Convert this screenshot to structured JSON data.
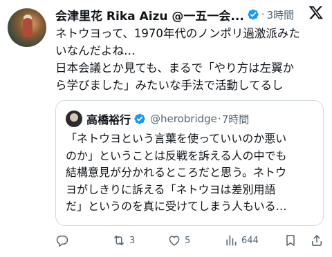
{
  "tweet": {
    "display_name": "会津里花 Rika Aizu @一五一会...",
    "time": "3時間",
    "separator": "·",
    "text_lines": [
      "ネトウヨって、1970年代のノンポリ過激派みた",
      "いなんだよね…",
      "日本会議とか見ても、まるで「やり方は左翼か",
      "ら学びました」みたいな手法で活動してるし"
    ]
  },
  "quote": {
    "display_name": "高橋裕行",
    "handle": "@herobridge",
    "separator": "·",
    "time": "7時間",
    "text_lines": [
      "「ネトウヨという言葉を使っていいのか悪い",
      "のか」ということは反戦を訴える人の中でも",
      "結構意見が分かれるところだと思う。ネトウ",
      "ヨがしきりに訴える「ネトウヨは差別用語",
      "だ」というのを真に受けてしまう人もいる…"
    ]
  },
  "actions": {
    "reply_count": "",
    "retweet_count": "3",
    "like_count": "5",
    "views_count": "644"
  },
  "colors": {
    "verified": "#1d9bf0",
    "muted": "#536471",
    "border": "#cfd9de"
  }
}
